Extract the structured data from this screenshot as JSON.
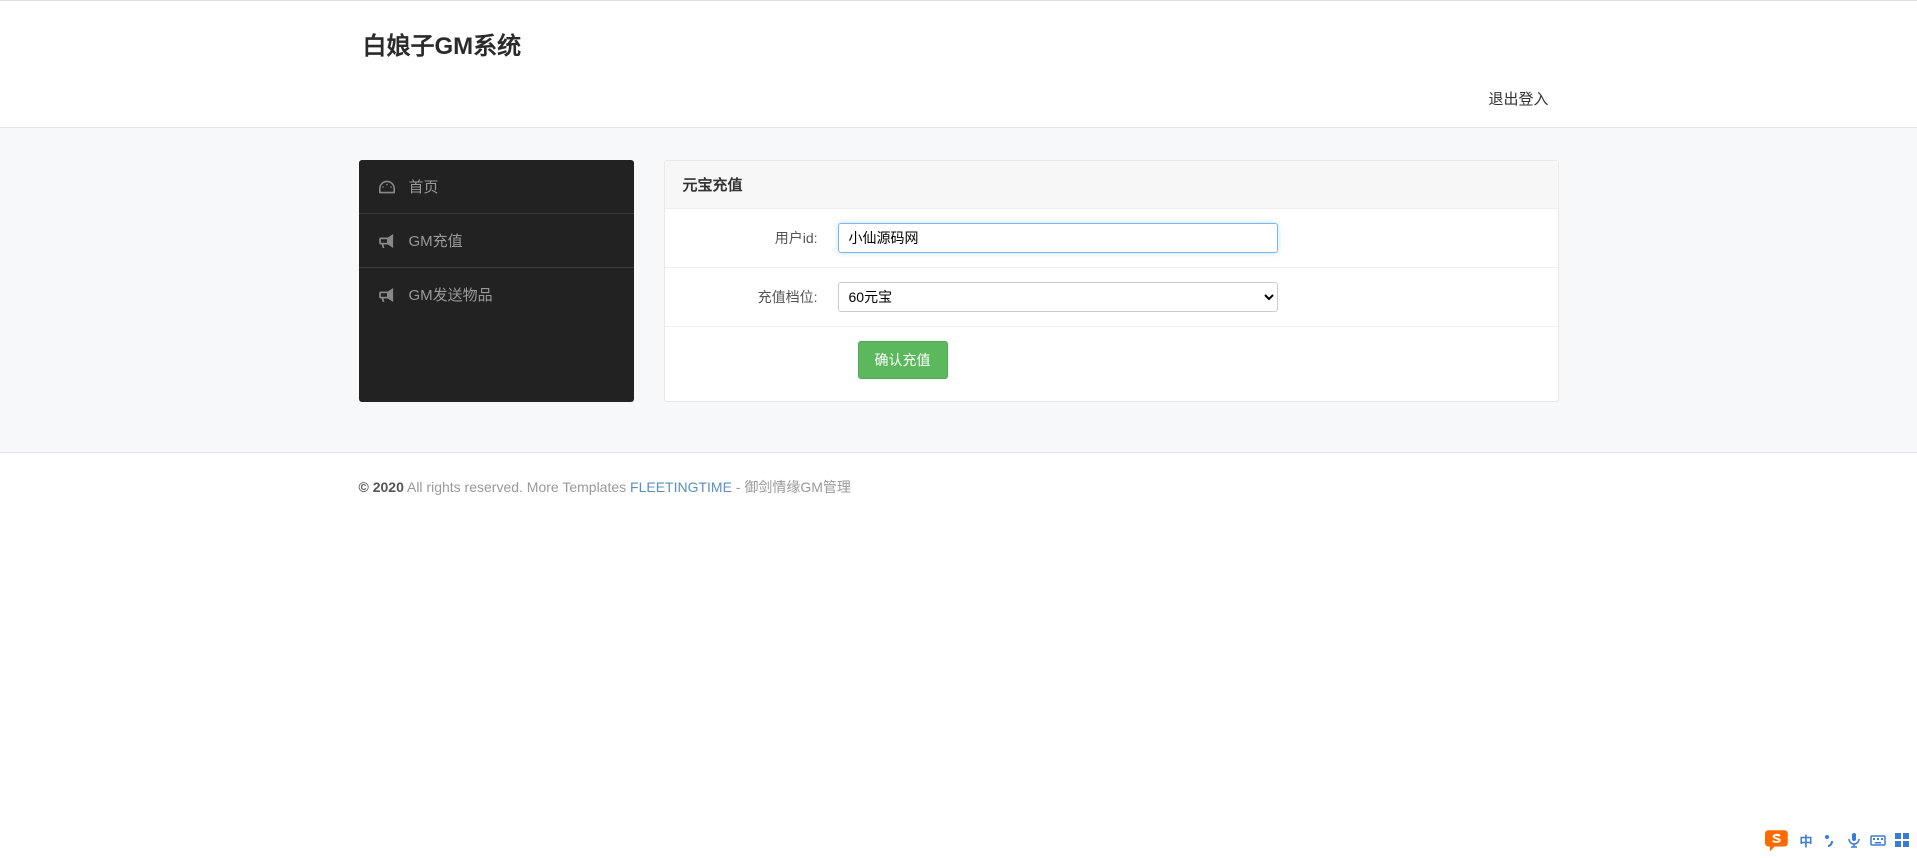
{
  "header": {
    "title": "白娘子GM系统",
    "logout_label": "退出登入"
  },
  "sidebar": {
    "items": [
      {
        "label": "首页",
        "icon": "dashboard-icon"
      },
      {
        "label": "GM充值",
        "icon": "bullhorn-icon"
      },
      {
        "label": "GM发送物品",
        "icon": "bullhorn-icon"
      }
    ]
  },
  "panel": {
    "title": "元宝充值"
  },
  "form": {
    "user_id_label": "用户id:",
    "user_id_value": "小仙源码网",
    "tier_label": "充值档位:",
    "tier_value": "60元宝",
    "submit_label": "确认充值"
  },
  "footer": {
    "copyright_strong": "© 2020",
    "rights_text": " All rights reserved. More Templates ",
    "link_text": "FLEETINGTIME",
    "suffix_text": " - 御剑情缘GM管理"
  },
  "ime": {
    "lang": "中"
  }
}
